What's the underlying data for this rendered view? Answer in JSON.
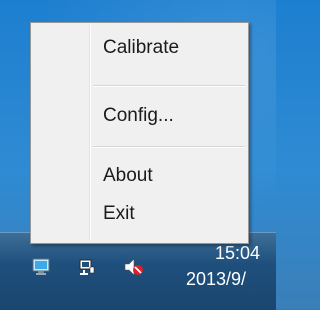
{
  "context_menu": {
    "items": [
      {
        "label": "Calibrate"
      },
      {
        "label": "Config..."
      },
      {
        "label": "About"
      },
      {
        "label": "Exit"
      }
    ]
  },
  "taskbar": {
    "clock": {
      "time": "15:04",
      "date": "2013/9/"
    },
    "tray_icons": [
      "display-monitor-icon",
      "network-icon",
      "volume-muted-icon"
    ]
  },
  "colors": {
    "desktop": "#2f8bd3",
    "taskbar": "#1f4f7c",
    "menu_background": "#f0f0f0",
    "mute_red": "#d9222a"
  }
}
